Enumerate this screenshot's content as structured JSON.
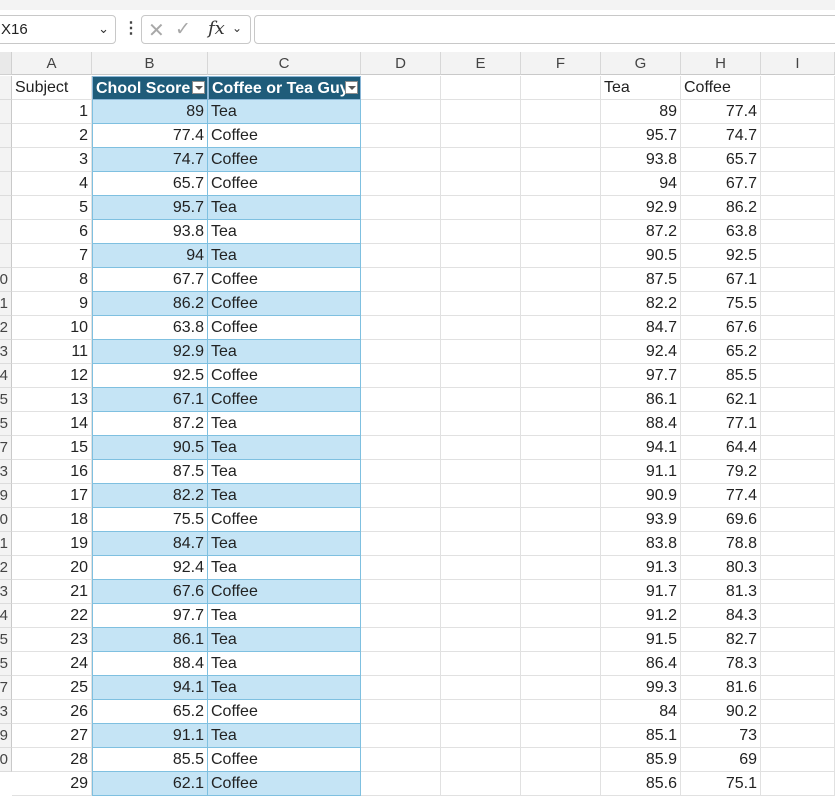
{
  "formula_bar": {
    "name_box": "X16",
    "name_box_chevron": "chevron-down-icon",
    "more_icon": "vertical-ellipsis-icon",
    "cancel_icon": "cancel-x-icon",
    "enter_icon": "checkmark-icon",
    "fx_label": "fx",
    "formula_value": ""
  },
  "columns": [
    "A",
    "B",
    "C",
    "D",
    "E",
    "F",
    "G",
    "H",
    "I"
  ],
  "row_numbers": [
    "",
    "",
    "",
    "",
    "",
    "",
    "",
    "",
    "0",
    "1",
    "2",
    "3",
    "4",
    "5",
    "5",
    "7",
    "3",
    "9",
    "0",
    "1",
    "2",
    "3",
    "4",
    "5",
    "5",
    "7",
    "3",
    "9",
    "0"
  ],
  "table": {
    "headers": {
      "subject": "Subject",
      "score": "Chool Score",
      "type": "Coffee or Tea Guy"
    },
    "rows": [
      [
        "1",
        "89",
        "Tea"
      ],
      [
        "2",
        "77.4",
        "Coffee"
      ],
      [
        "3",
        "74.7",
        "Coffee"
      ],
      [
        "4",
        "65.7",
        "Coffee"
      ],
      [
        "5",
        "95.7",
        "Tea"
      ],
      [
        "6",
        "93.8",
        "Tea"
      ],
      [
        "7",
        "94",
        "Tea"
      ],
      [
        "8",
        "67.7",
        "Coffee"
      ],
      [
        "9",
        "86.2",
        "Coffee"
      ],
      [
        "10",
        "63.8",
        "Coffee"
      ],
      [
        "11",
        "92.9",
        "Tea"
      ],
      [
        "12",
        "92.5",
        "Coffee"
      ],
      [
        "13",
        "67.1",
        "Coffee"
      ],
      [
        "14",
        "87.2",
        "Tea"
      ],
      [
        "15",
        "90.5",
        "Tea"
      ],
      [
        "16",
        "87.5",
        "Tea"
      ],
      [
        "17",
        "82.2",
        "Tea"
      ],
      [
        "18",
        "75.5",
        "Coffee"
      ],
      [
        "19",
        "84.7",
        "Tea"
      ],
      [
        "20",
        "92.4",
        "Tea"
      ],
      [
        "21",
        "67.6",
        "Coffee"
      ],
      [
        "22",
        "97.7",
        "Tea"
      ],
      [
        "23",
        "86.1",
        "Tea"
      ],
      [
        "24",
        "88.4",
        "Tea"
      ],
      [
        "25",
        "94.1",
        "Tea"
      ],
      [
        "26",
        "65.2",
        "Coffee"
      ],
      [
        "27",
        "91.1",
        "Tea"
      ],
      [
        "28",
        "85.5",
        "Coffee"
      ],
      [
        "29",
        "62.1",
        "Coffee"
      ]
    ]
  },
  "side": {
    "headers": {
      "tea": "Tea",
      "coffee": "Coffee"
    },
    "rows": [
      [
        "89",
        "77.4"
      ],
      [
        "95.7",
        "74.7"
      ],
      [
        "93.8",
        "65.7"
      ],
      [
        "94",
        "67.7"
      ],
      [
        "92.9",
        "86.2"
      ],
      [
        "87.2",
        "63.8"
      ],
      [
        "90.5",
        "92.5"
      ],
      [
        "87.5",
        "67.1"
      ],
      [
        "82.2",
        "75.5"
      ],
      [
        "84.7",
        "67.6"
      ],
      [
        "92.4",
        "65.2"
      ],
      [
        "97.7",
        "85.5"
      ],
      [
        "86.1",
        "62.1"
      ],
      [
        "88.4",
        "77.1"
      ],
      [
        "94.1",
        "64.4"
      ],
      [
        "91.1",
        "79.2"
      ],
      [
        "90.9",
        "77.4"
      ],
      [
        "93.9",
        "69.6"
      ],
      [
        "83.8",
        "78.8"
      ],
      [
        "91.3",
        "80.3"
      ],
      [
        "91.7",
        "81.3"
      ],
      [
        "91.2",
        "84.3"
      ],
      [
        "91.5",
        "82.7"
      ],
      [
        "86.4",
        "78.3"
      ],
      [
        "99.3",
        "81.6"
      ],
      [
        "84",
        "90.2"
      ],
      [
        "85.1",
        "73"
      ],
      [
        "85.9",
        "69"
      ],
      [
        "85.6",
        "75.1"
      ]
    ]
  },
  "colors": {
    "header_bg": "#1f5c7a",
    "band": "#c5e4f5",
    "table_border": "#7fc0e0"
  }
}
